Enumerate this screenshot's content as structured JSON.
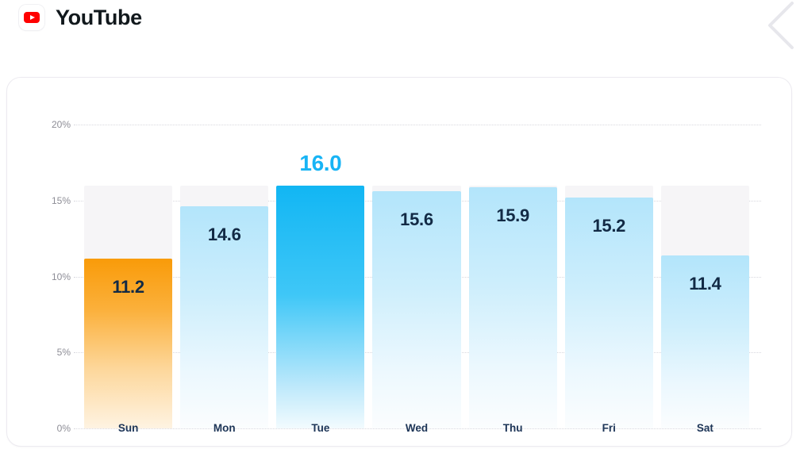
{
  "header": {
    "title": "YouTube",
    "icon": "youtube-icon"
  },
  "corner": {
    "icon": "chevron-left-icon"
  },
  "colors": {
    "accent_blue": "#18b4f5",
    "accent_orange": "#f99b09",
    "brand_red": "#ff0000",
    "label_navy": "#122a45",
    "tick_gray": "#8d8d96",
    "track_gray": "#f6f5f7",
    "card_border": "#eceaf0"
  },
  "chart_data": {
    "type": "bar",
    "title": "",
    "xlabel": "",
    "ylabel": "",
    "ylim": [
      0,
      20
    ],
    "grid": true,
    "legend": "none",
    "y_ticks": [
      "0%",
      "5%",
      "10%",
      "15%",
      "20%"
    ],
    "y_tick_values": [
      0,
      5,
      10,
      15,
      20
    ],
    "categories": [
      "Sun",
      "Mon",
      "Tue",
      "Wed",
      "Thu",
      "Fri",
      "Sat"
    ],
    "values": [
      11.2,
      14.6,
      16.0,
      15.6,
      15.9,
      15.2,
      11.4
    ],
    "value_labels": [
      "11.2",
      "14.6",
      "16.0",
      "15.6",
      "15.9",
      "15.2",
      "11.4"
    ],
    "track_max": 16.0,
    "highlighted_index": 2,
    "highlight_label": "16.0",
    "bar_styles": [
      "orange",
      "blue",
      "blue-highlight",
      "blue",
      "blue",
      "blue",
      "blue"
    ]
  }
}
